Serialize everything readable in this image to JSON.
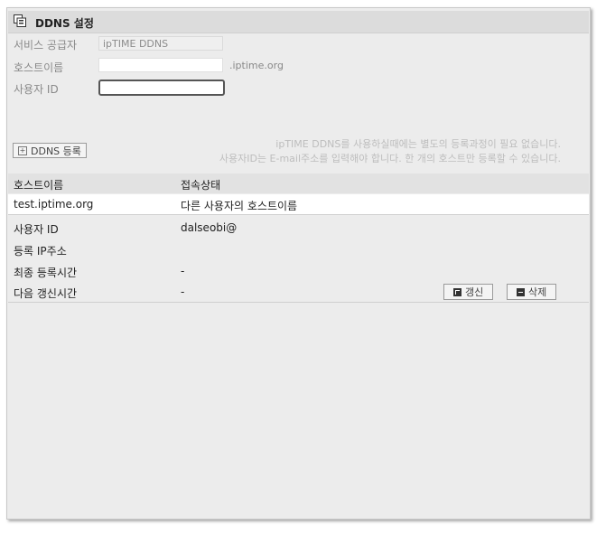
{
  "header": {
    "title": "DDNS 설정"
  },
  "form": {
    "provider_label": "서비스 공급자",
    "provider_value": "ipTIME DDNS",
    "hostname_label": "호스트이름",
    "hostname_value": "",
    "hostname_suffix": ".iptime.org",
    "userid_label": "사용자 ID",
    "userid_value": ""
  },
  "register_button": "DDNS 등록",
  "notice": {
    "line1": "ipTIME DDNS를 사용하실때에는 별도의 등록과정이 필요 없습니다.",
    "line2": "사용자ID는 E-mail주소를 입력해야 합니다. 한 개의 호스트만 등록할 수 있습니다."
  },
  "table": {
    "columns": [
      "호스트이름",
      "접속상태"
    ],
    "rows": [
      {
        "host": "test.iptime.org",
        "status": "다른 사용자의 호스트이름"
      }
    ]
  },
  "details": {
    "userid_label": "사용자 ID",
    "userid_value": "dalseobi@",
    "ip_label": "등록 IP주소",
    "ip_value": "",
    "last_reg_label": "최종 등록시간",
    "last_reg_value": "-",
    "next_update_label": "다음 갱신시간",
    "next_update_value": "-"
  },
  "actions": {
    "refresh": "갱신",
    "delete": "삭제"
  },
  "colors": {
    "panel_bg": "#ececec",
    "title_bg": "#dcdcdc",
    "row_bg": "#ffffff"
  }
}
